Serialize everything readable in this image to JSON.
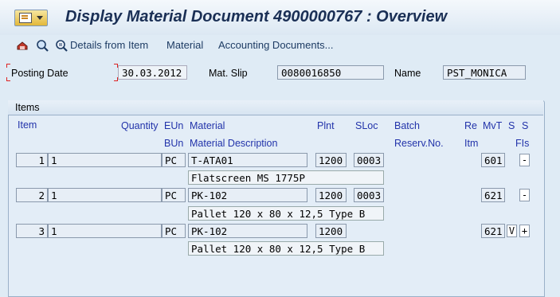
{
  "window": {
    "title": "Display Material Document 4900000767 : Overview"
  },
  "toolbar": {
    "details_label": "Details from Item",
    "material_label": "Material",
    "accounting_label": "Accounting Documents..."
  },
  "header": {
    "posting_date_label": "Posting Date",
    "posting_date_value": "30.03.2012",
    "mat_slip_label": "Mat. Slip",
    "mat_slip_value": "0080016850",
    "name_label": "Name",
    "name_value": "PST_MONICA"
  },
  "items": {
    "group_title": "Items",
    "columns_row1": {
      "item": "Item",
      "quantity": "Quantity",
      "eun": "EUn",
      "material": "Material",
      "plnt": "Plnt",
      "sloc": "SLoc",
      "batch": "Batch",
      "re": "Re",
      "mvt": "MvT",
      "s1": "S",
      "s2": "S"
    },
    "columns_row2": {
      "bun": "BUn",
      "material_description": "Material Description",
      "reserv": "Reserv.No.",
      "itm": "Itm",
      "fis": "FIs"
    },
    "rows": [
      {
        "item": "1",
        "quantity": "1",
        "unit": "PC",
        "material": "T-ATA01",
        "plant": "1200",
        "sloc": "0003",
        "mvt": "601",
        "s": "",
        "fis": "-",
        "description": "Flatscreen MS 1775P"
      },
      {
        "item": "2",
        "quantity": "1",
        "unit": "PC",
        "material": "PK-102",
        "plant": "1200",
        "sloc": "0003",
        "mvt": "621",
        "s": "",
        "fis": "-",
        "description": "Pallet 120 x 80 x 12,5 Type B"
      },
      {
        "item": "3",
        "quantity": "1",
        "unit": "PC",
        "material": "PK-102",
        "plant": "1200",
        "sloc": "",
        "mvt": "621",
        "s": "V",
        "fis": "+",
        "description": "Pallet 120 x 80 x 12,5 Type B"
      }
    ]
  },
  "icons": {
    "menu": "sap-menu-icon",
    "other_document": "other-document-icon",
    "display": "display-icon",
    "details": "details-icon"
  },
  "colors": {
    "title": "#1a2f55",
    "column_header": "#2233aa",
    "background": "#dfebf5"
  }
}
